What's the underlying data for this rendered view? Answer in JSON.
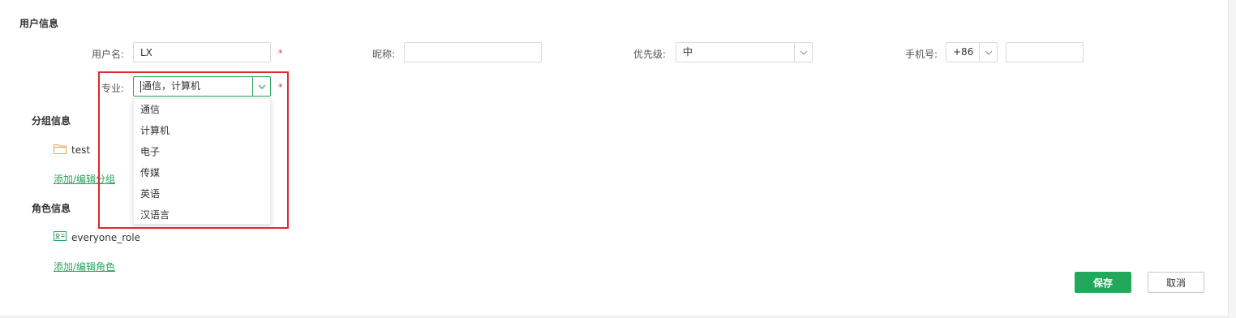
{
  "user_info": {
    "title": "用户信息",
    "username": {
      "label": "用户名:",
      "value": "LX",
      "required": "*"
    },
    "nickname": {
      "label": "昵称:",
      "value": ""
    },
    "priority": {
      "label": "优先级:",
      "value": "中"
    },
    "phone": {
      "label": "手机号:",
      "country_code": "+86",
      "value": ""
    },
    "major": {
      "label": "专业:",
      "value": "通信，计算机",
      "required": "*",
      "options": [
        "通信",
        "计算机",
        "电子",
        "传媒",
        "英语",
        "汉语言"
      ]
    }
  },
  "group_info": {
    "title": "分组信息",
    "items": [
      {
        "name": "test",
        "icon": "folder-icon"
      }
    ],
    "edit_link": "添加/编辑分组"
  },
  "role_info": {
    "title": "角色信息",
    "items": [
      {
        "name": "everyone_role",
        "icon": "id-card-icon"
      }
    ],
    "edit_link": "添加/编辑角色"
  },
  "actions": {
    "save": "保存",
    "cancel": "取消"
  },
  "colors": {
    "accent": "#22a85a",
    "highlight": "#e0282e",
    "required": "#e0282e"
  }
}
